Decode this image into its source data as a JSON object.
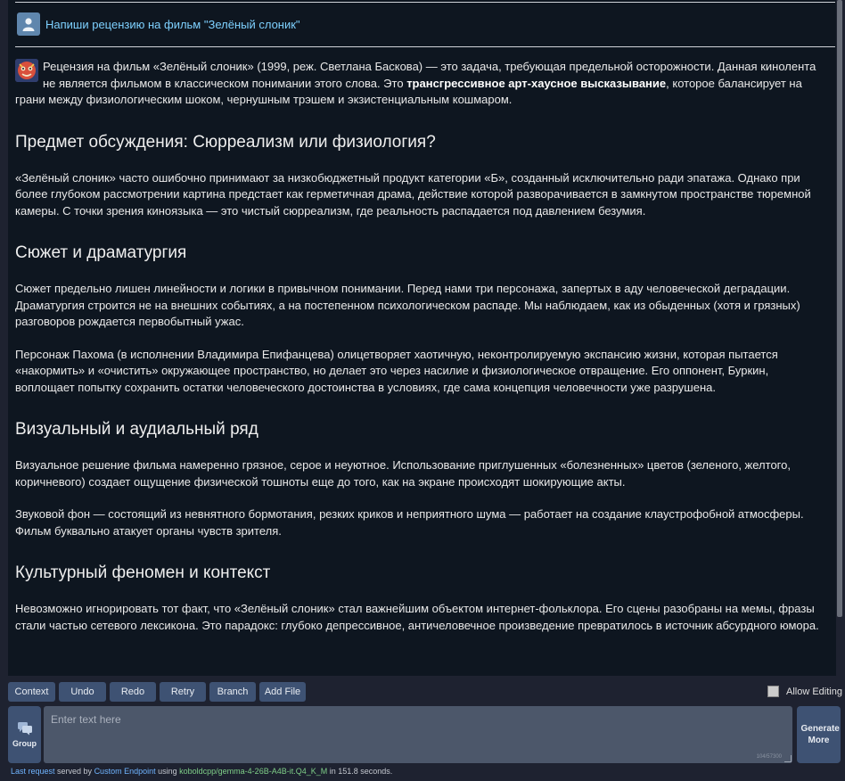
{
  "chat": {
    "user_message": "Напиши рецензию на фильм \"Зелёный слоник\"",
    "response": {
      "intro_before_bold": "Рецензия на фильм «Зелёный слоник» (1999, реж. Светлана Баскова) — это задача, требующая предельной осторожности. Данная кинолента не является фильмом в классическом понимании этого слова. Это ",
      "intro_bold": "трансгрессивное арт-хаусное высказывание",
      "intro_after_bold": ", которое балансирует на грани между физиологическим шоком, чернушным трэшем и экзистенциальным кошмаром.",
      "h1": "Предмет обсуждения: Сюрреализм или физиология?",
      "p1": "«Зелёный слоник» часто ошибочно принимают за низкобюджетный продукт категории «Б», созданный исключительно ради эпатажа. Однако при более глубоком рассмотрении картина предстает как герметичная драма, действие которой разворачивается в замкнутом пространстве тюремной камеры. С точки зрения киноязыка — это чистый сюрреализм, где реальность распадается под давлением безумия.",
      "h2": "Сюжет и драматургия",
      "p2": "Сюжет предельно лишен линейности и логики в привычном понимании. Перед нами три персонажа, запертых в аду человеческой деградации. Драматургия строится не на внешних событиях, а на постепенном психологическом распаде. Мы наблюдаем, как из обыденных (хотя и грязных) разговоров рождается первобытный ужас.",
      "p3": "Персонаж Пахома (в исполнении Владимира Епифанцева) олицетворяет хаотичную, неконтролируемую экспансию жизни, которая пытается «накормить» и «очистить» окружающее пространство, но делает это через насилие и физиологическое отвращение. Его оппонент, Буркин, воплощает попытку сохранить остатки человеческого достоинства в условиях, где сама концепция человечности уже разрушена.",
      "h3": "Визуальный и аудиальный ряд",
      "p4": "Визуальное решение фильма намеренно грязное, серое и неуютное. Использование приглушенных «болезненных» цветов (зеленого, желтого, коричневого) создает ощущение физической тошноты еще до того, как на экране происходят шокирующие акты.",
      "p5": "Звуковой фон — состоящий из невнятного бормотания, резких криков и неприятного шума — работает на создание клаустрофобной атмосферы. Фильм буквально атакует органы чувств зрителя.",
      "h4": "Культурный феномен и контекст",
      "p6": "Невозможно игнорировать тот факт, что «Зелёный слоник» стал важнейшим объектом интернет-фольклора. Его сцены разобраны на мемы, фразы стали частью сетевого лексикона. Это парадокс: глубоко депрессивное, античеловечное произведение превратилось в источник абсурдного юмора."
    }
  },
  "toolbar": {
    "context": "Context",
    "undo": "Undo",
    "redo": "Redo",
    "retry": "Retry",
    "branch": "Branch",
    "add_file": "Add File",
    "allow_editing": "Allow Editing"
  },
  "input": {
    "group_label": "Group",
    "placeholder": "Enter text here",
    "counter": "104/57300",
    "generate_label": "Generate More"
  },
  "status": {
    "last_request": "Last request",
    "served_by": " served by ",
    "endpoint": "Custom Endpoint",
    "using": " using ",
    "model": "koboldcpp/gemma-4-26B-A4B-it.Q4_K_M",
    "in": " in ",
    "time": "151.8 seconds."
  },
  "colors": {
    "accent_blue": "#7ed1ff",
    "button_bg": "#3e5273",
    "model_green": "#7fcf88"
  },
  "icons": {
    "user_avatar": "person-icon",
    "bot_avatar": "bot-mask-icon",
    "group": "chat-bubbles-icon"
  }
}
